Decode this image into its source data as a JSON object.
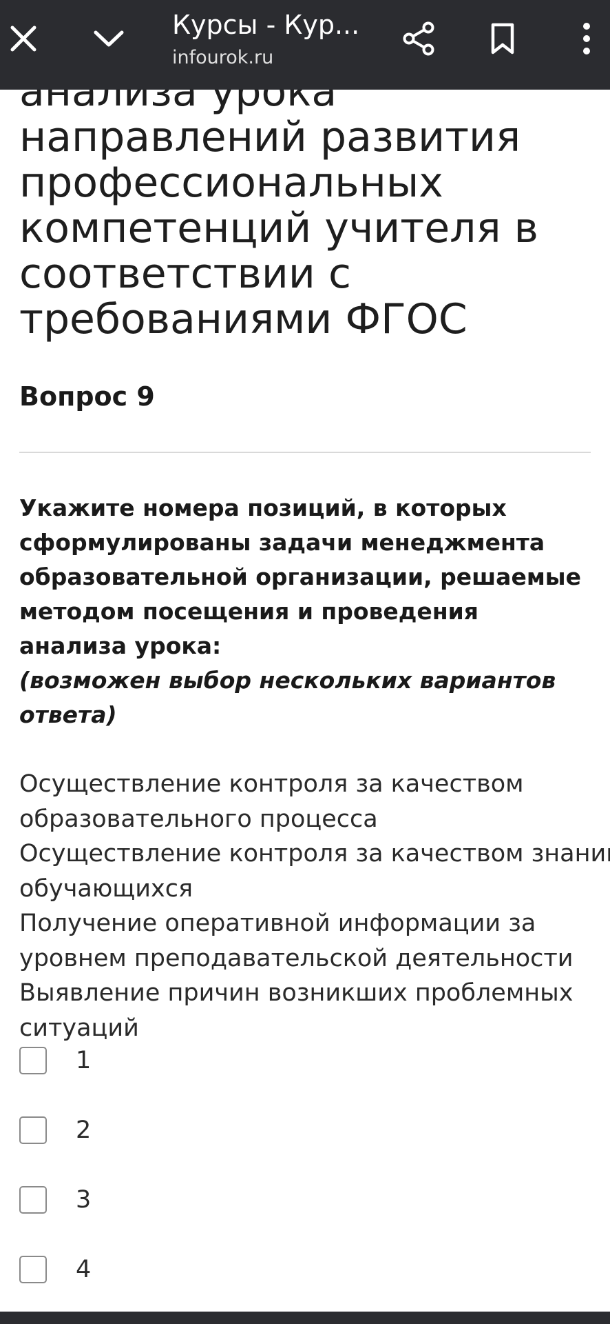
{
  "browser": {
    "title": "Курсы - Кур...",
    "url": "infourok.ru",
    "icons": {
      "close": "close-icon",
      "minimize": "chevron-down-icon",
      "share": "share-icon",
      "bookmark": "bookmark-icon",
      "menu": "more-vertical-icon"
    },
    "bar_color": "#2b2c30"
  },
  "heading": {
    "lines": [
      "анализа урока",
      "направлений развития",
      "профессиональных",
      "компетенций учителя в",
      "соответствии с",
      "требованиями ФГОС"
    ]
  },
  "question": {
    "number_label": "Вопрос 9",
    "text_lines": [
      "Укажите номера позиций, в которых",
      "сформулированы задачи менеджмента",
      "образовательной организации, решаемые",
      "методом посещения и проведения",
      "анализа урока:"
    ],
    "note_lines": [
      "(возможен выбор нескольких вариантов",
      "ответа)"
    ],
    "options_lines": [
      "Осуществление контроля за качеством",
      "образовательного процесса",
      "Осуществление контроля за качеством знаний",
      "обучающихся",
      "Получение оперативной информации за",
      "уровнем преподавательской деятельности",
      "Выявление причин возникших проблемных",
      "ситуаций"
    ],
    "answers": [
      {
        "label": "1",
        "checked": false
      },
      {
        "label": "2",
        "checked": false
      },
      {
        "label": "3",
        "checked": false
      },
      {
        "label": "4",
        "checked": false
      }
    ]
  }
}
